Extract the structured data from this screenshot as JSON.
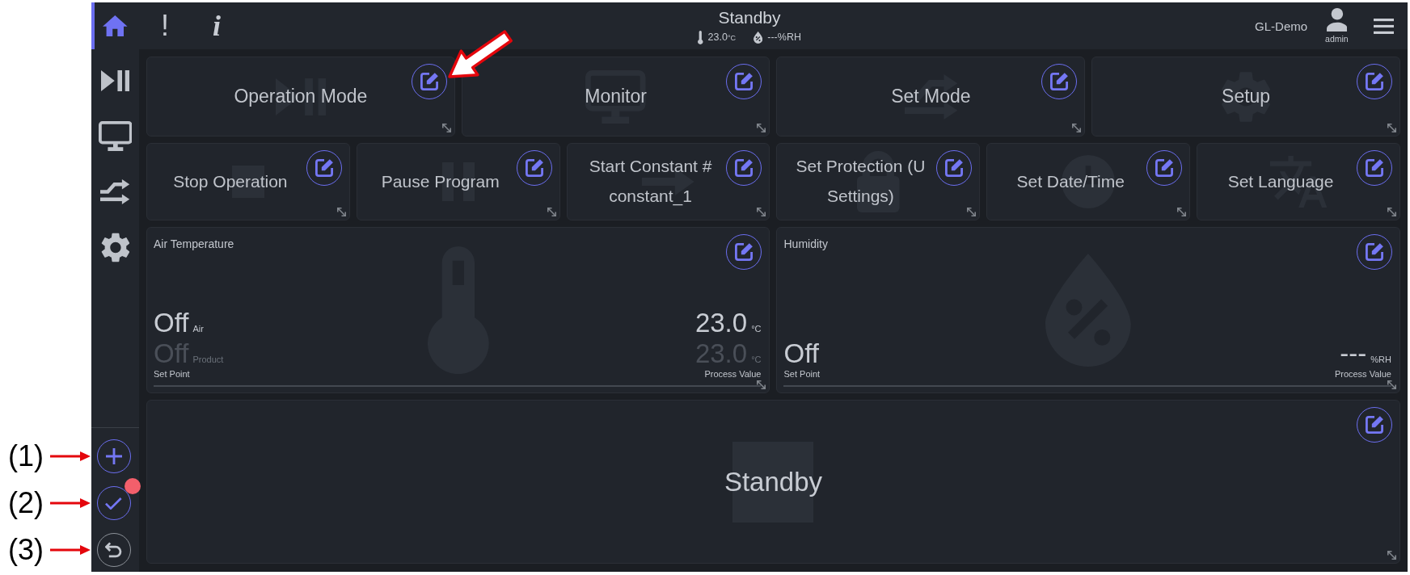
{
  "nav": {
    "items": [
      {
        "selected": true
      },
      {
        "selected": false
      },
      {
        "selected": false
      },
      {
        "selected": false
      },
      {
        "selected": false
      }
    ]
  },
  "header": {
    "icons": [
      {
        "kind": "alert",
        "text": "!"
      },
      {
        "kind": "info",
        "text": "i"
      }
    ],
    "title": "Standby",
    "temperature": {
      "value": "23.0",
      "unit": "°C"
    },
    "humidity": "---%RH",
    "site": "GL-Demo",
    "user": "admin"
  },
  "sidebar_actions": [
    {
      "disabled": false,
      "badge": false
    },
    {
      "disabled": false,
      "badge": true
    },
    {
      "disabled": true,
      "badge": false
    }
  ],
  "tile_rows": [
    [
      {
        "kind": "action",
        "lines": [
          "Operation Mode"
        ]
      },
      {
        "kind": "action",
        "lines": [
          "Monitor"
        ]
      },
      {
        "kind": "action",
        "lines": [
          "Set Mode"
        ]
      },
      {
        "kind": "action",
        "lines": [
          "Setup"
        ]
      }
    ],
    [
      {
        "kind": "action",
        "lines": [
          "Stop Operation"
        ]
      },
      {
        "kind": "action",
        "lines": [
          "Pause Program"
        ]
      },
      {
        "kind": "action",
        "lines": [
          "Start Constant #",
          "constant_1"
        ]
      },
      {
        "kind": "action",
        "lines": [
          "Set Protection (U",
          "Settings)"
        ]
      },
      {
        "kind": "action",
        "lines": [
          "Set Date/Time"
        ]
      },
      {
        "kind": "action",
        "lines": [
          "Set Language"
        ]
      }
    ],
    [
      {
        "kind": "gauge",
        "title": "Air Temperature",
        "set_point": {
          "label": "Set Point",
          "rows": [
            {
              "value": "Off",
              "tag": "Air",
              "active": true
            },
            {
              "value": "Off",
              "tag": "Product",
              "active": false
            }
          ]
        },
        "process_value": {
          "label": "Process Value",
          "rows": [
            {
              "value": "23.0",
              "unit": "°C",
              "active": true
            },
            {
              "value": "23.0",
              "unit": "°C",
              "active": false
            }
          ]
        }
      },
      {
        "kind": "gauge",
        "title": "Humidity",
        "set_point": {
          "label": "Set Point",
          "rows": [
            {
              "value": "Off",
              "active": true
            }
          ]
        },
        "process_value": {
          "label": "Process Value",
          "rows": [
            {
              "value": "---",
              "unit": "%RH",
              "active": true
            }
          ]
        }
      }
    ],
    [
      {
        "kind": "status",
        "text": "Standby"
      }
    ]
  ],
  "annotations": {
    "callouts": [
      {
        "label": "(1)"
      },
      {
        "label": "(2)"
      },
      {
        "label": "(3)"
      }
    ]
  }
}
